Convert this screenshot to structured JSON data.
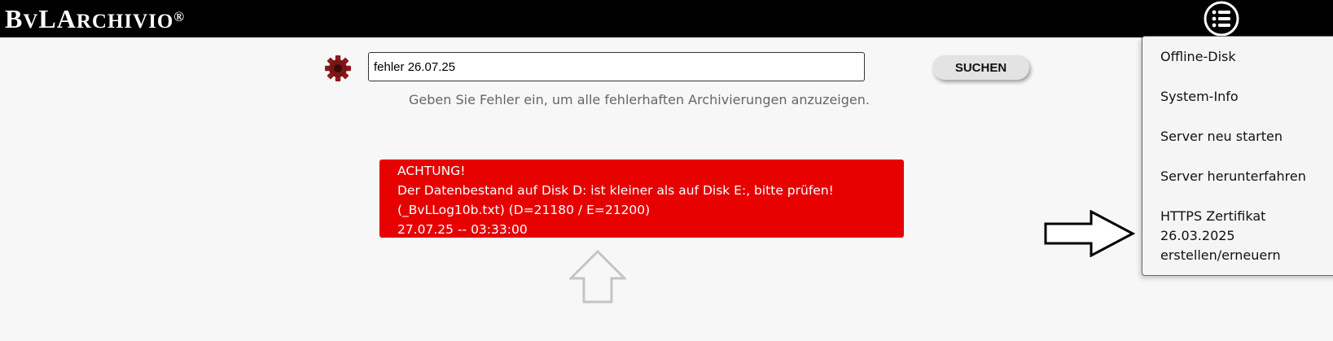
{
  "header": {
    "logo_b": "B",
    "logo_v": "V",
    "logo_la": "LA",
    "logo_rchivio": "RCHIVIO",
    "logo_reg": "®",
    "menu_icon": "list-icon"
  },
  "search": {
    "value": "fehler 26.07.25",
    "button_label": "SUCHEN",
    "hint": "Geben Sie Fehler ein, um alle fehlerhaften Archivierungen anzuzeigen.",
    "settings_icon": "gear-icon"
  },
  "alert": {
    "line1": "ACHTUNG!",
    "line2": "Der Datenbestand auf Disk D: ist kleiner als auf Disk E:, bitte prüfen!",
    "line3": "(_BvLLog10b.txt) (D=21180 / E=21200)",
    "line4": "27.07.25 -- 03:33:00",
    "color": "#e60000"
  },
  "menu": {
    "items": [
      {
        "label": "Offline-Disk"
      },
      {
        "label": "System-Info"
      },
      {
        "label": "Server neu starten"
      },
      {
        "label": "Server herunterfahren"
      },
      {
        "label_line1": "HTTPS Zertifikat",
        "label_line2": "26.03.2025",
        "label_line3": "erstellen/erneuern"
      }
    ]
  },
  "annotations": {
    "up_arrow_icon": "arrow-up-icon",
    "right_arrow_icon": "arrow-right-icon"
  }
}
